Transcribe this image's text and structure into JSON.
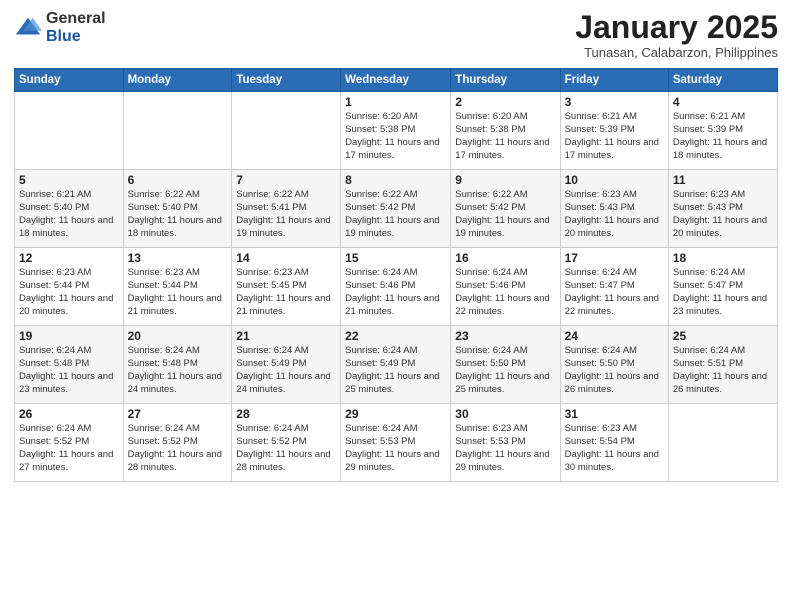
{
  "logo": {
    "general": "General",
    "blue": "Blue"
  },
  "title": "January 2025",
  "subtitle": "Tunasan, Calabarzon, Philippines",
  "days_header": [
    "Sunday",
    "Monday",
    "Tuesday",
    "Wednesday",
    "Thursday",
    "Friday",
    "Saturday"
  ],
  "weeks": [
    [
      {
        "day": "",
        "info": ""
      },
      {
        "day": "",
        "info": ""
      },
      {
        "day": "",
        "info": ""
      },
      {
        "day": "1",
        "info": "Sunrise: 6:20 AM\nSunset: 5:38 PM\nDaylight: 11 hours and 17 minutes."
      },
      {
        "day": "2",
        "info": "Sunrise: 6:20 AM\nSunset: 5:38 PM\nDaylight: 11 hours and 17 minutes."
      },
      {
        "day": "3",
        "info": "Sunrise: 6:21 AM\nSunset: 5:39 PM\nDaylight: 11 hours and 17 minutes."
      },
      {
        "day": "4",
        "info": "Sunrise: 6:21 AM\nSunset: 5:39 PM\nDaylight: 11 hours and 18 minutes."
      }
    ],
    [
      {
        "day": "5",
        "info": "Sunrise: 6:21 AM\nSunset: 5:40 PM\nDaylight: 11 hours and 18 minutes."
      },
      {
        "day": "6",
        "info": "Sunrise: 6:22 AM\nSunset: 5:40 PM\nDaylight: 11 hours and 18 minutes."
      },
      {
        "day": "7",
        "info": "Sunrise: 6:22 AM\nSunset: 5:41 PM\nDaylight: 11 hours and 19 minutes."
      },
      {
        "day": "8",
        "info": "Sunrise: 6:22 AM\nSunset: 5:42 PM\nDaylight: 11 hours and 19 minutes."
      },
      {
        "day": "9",
        "info": "Sunrise: 6:22 AM\nSunset: 5:42 PM\nDaylight: 11 hours and 19 minutes."
      },
      {
        "day": "10",
        "info": "Sunrise: 6:23 AM\nSunset: 5:43 PM\nDaylight: 11 hours and 20 minutes."
      },
      {
        "day": "11",
        "info": "Sunrise: 6:23 AM\nSunset: 5:43 PM\nDaylight: 11 hours and 20 minutes."
      }
    ],
    [
      {
        "day": "12",
        "info": "Sunrise: 6:23 AM\nSunset: 5:44 PM\nDaylight: 11 hours and 20 minutes."
      },
      {
        "day": "13",
        "info": "Sunrise: 6:23 AM\nSunset: 5:44 PM\nDaylight: 11 hours and 21 minutes."
      },
      {
        "day": "14",
        "info": "Sunrise: 6:23 AM\nSunset: 5:45 PM\nDaylight: 11 hours and 21 minutes."
      },
      {
        "day": "15",
        "info": "Sunrise: 6:24 AM\nSunset: 5:46 PM\nDaylight: 11 hours and 21 minutes."
      },
      {
        "day": "16",
        "info": "Sunrise: 6:24 AM\nSunset: 5:46 PM\nDaylight: 11 hours and 22 minutes."
      },
      {
        "day": "17",
        "info": "Sunrise: 6:24 AM\nSunset: 5:47 PM\nDaylight: 11 hours and 22 minutes."
      },
      {
        "day": "18",
        "info": "Sunrise: 6:24 AM\nSunset: 5:47 PM\nDaylight: 11 hours and 23 minutes."
      }
    ],
    [
      {
        "day": "19",
        "info": "Sunrise: 6:24 AM\nSunset: 5:48 PM\nDaylight: 11 hours and 23 minutes."
      },
      {
        "day": "20",
        "info": "Sunrise: 6:24 AM\nSunset: 5:48 PM\nDaylight: 11 hours and 24 minutes."
      },
      {
        "day": "21",
        "info": "Sunrise: 6:24 AM\nSunset: 5:49 PM\nDaylight: 11 hours and 24 minutes."
      },
      {
        "day": "22",
        "info": "Sunrise: 6:24 AM\nSunset: 5:49 PM\nDaylight: 11 hours and 25 minutes."
      },
      {
        "day": "23",
        "info": "Sunrise: 6:24 AM\nSunset: 5:50 PM\nDaylight: 11 hours and 25 minutes."
      },
      {
        "day": "24",
        "info": "Sunrise: 6:24 AM\nSunset: 5:50 PM\nDaylight: 11 hours and 26 minutes."
      },
      {
        "day": "25",
        "info": "Sunrise: 6:24 AM\nSunset: 5:51 PM\nDaylight: 11 hours and 26 minutes."
      }
    ],
    [
      {
        "day": "26",
        "info": "Sunrise: 6:24 AM\nSunset: 5:52 PM\nDaylight: 11 hours and 27 minutes."
      },
      {
        "day": "27",
        "info": "Sunrise: 6:24 AM\nSunset: 5:52 PM\nDaylight: 11 hours and 28 minutes."
      },
      {
        "day": "28",
        "info": "Sunrise: 6:24 AM\nSunset: 5:52 PM\nDaylight: 11 hours and 28 minutes."
      },
      {
        "day": "29",
        "info": "Sunrise: 6:24 AM\nSunset: 5:53 PM\nDaylight: 11 hours and 29 minutes."
      },
      {
        "day": "30",
        "info": "Sunrise: 6:23 AM\nSunset: 5:53 PM\nDaylight: 11 hours and 29 minutes."
      },
      {
        "day": "31",
        "info": "Sunrise: 6:23 AM\nSunset: 5:54 PM\nDaylight: 11 hours and 30 minutes."
      },
      {
        "day": "",
        "info": ""
      }
    ]
  ]
}
